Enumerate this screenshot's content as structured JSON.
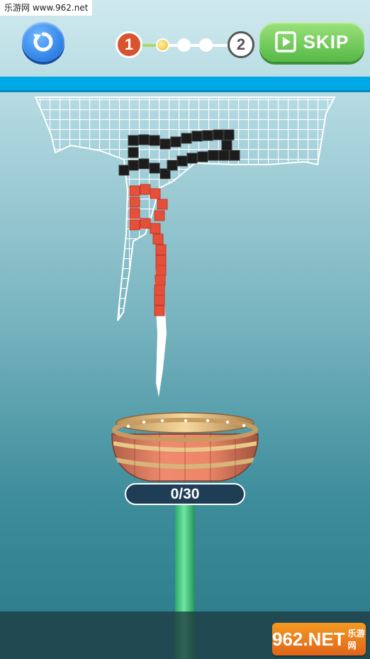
{
  "watermark": {
    "text": "乐游网 www.962.net"
  },
  "header": {
    "progress": {
      "current_level": "1",
      "next_level": "2",
      "steps_total": 3,
      "steps_completed": 1
    },
    "skip_label": "SKIP"
  },
  "game": {
    "counter": "0/30",
    "colors": {
      "ceiling": "#00a8e6",
      "pole": "#3fcf7d",
      "block_red": "#e5503a",
      "block_black": "#1c1c1c",
      "net": "#ffffff"
    }
  },
  "logo": {
    "main": "962.NET",
    "sub": "乐游网"
  }
}
